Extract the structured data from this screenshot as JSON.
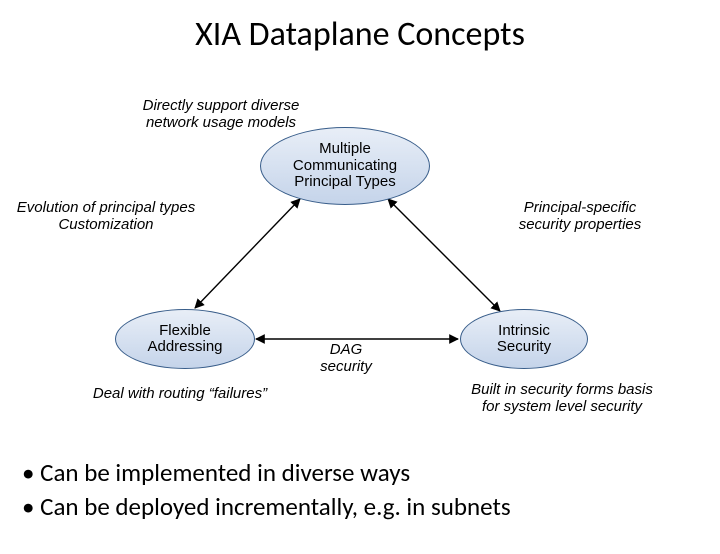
{
  "title": "XIA Dataplane Concepts",
  "nodes": {
    "top": "Multiple\nCommunicating\nPrincipal Types",
    "left": "Flexible\nAddressing",
    "right": "Intrinsic\nSecurity"
  },
  "labels": {
    "top": "Directly support diverse\nnetwork usage models",
    "left": "Evolution of principal types\nCustomization",
    "right": "Principal-specific\nsecurity properties",
    "bottom_left": "Deal with routing “failures”",
    "middle": "DAG\nsecurity",
    "bottom_right": "Built in security forms basis\nfor system level security"
  },
  "bullets": [
    "Can be implemented in diverse ways",
    "Can be deployed incrementally, e.g. in subnets"
  ]
}
